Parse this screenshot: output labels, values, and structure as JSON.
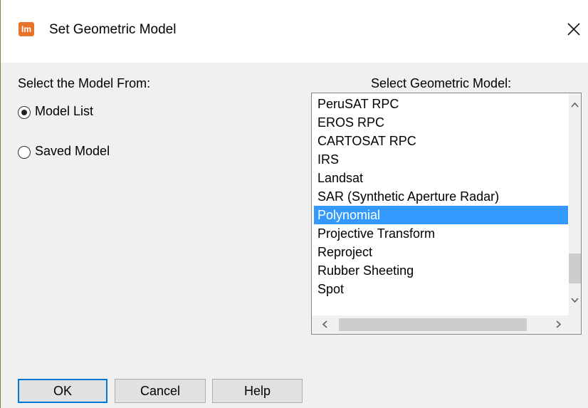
{
  "dialog": {
    "title": "Set Geometric Model",
    "app_icon_text": "Im",
    "close_symbol": "×"
  },
  "left": {
    "label": "Select the Model From:",
    "options": [
      {
        "label": "Model List",
        "selected": true
      },
      {
        "label": "Saved Model",
        "selected": false
      }
    ]
  },
  "right": {
    "label": "Select Geometric Model:",
    "items": [
      "PeruSAT RPC",
      "EROS RPC",
      "CARTOSAT RPC",
      "IRS",
      "Landsat",
      "SAR (Synthetic Aperture Radar)",
      "Polynomial",
      "Projective Transform",
      "Reproject",
      "Rubber Sheeting",
      "Spot"
    ],
    "selected_item": "Polynomial"
  },
  "buttons": {
    "ok": "OK",
    "cancel": "Cancel",
    "help": "Help"
  },
  "colors": {
    "selection": "#3399ff",
    "app_icon": "#e8732a",
    "default_button_border": "#0078d7"
  }
}
